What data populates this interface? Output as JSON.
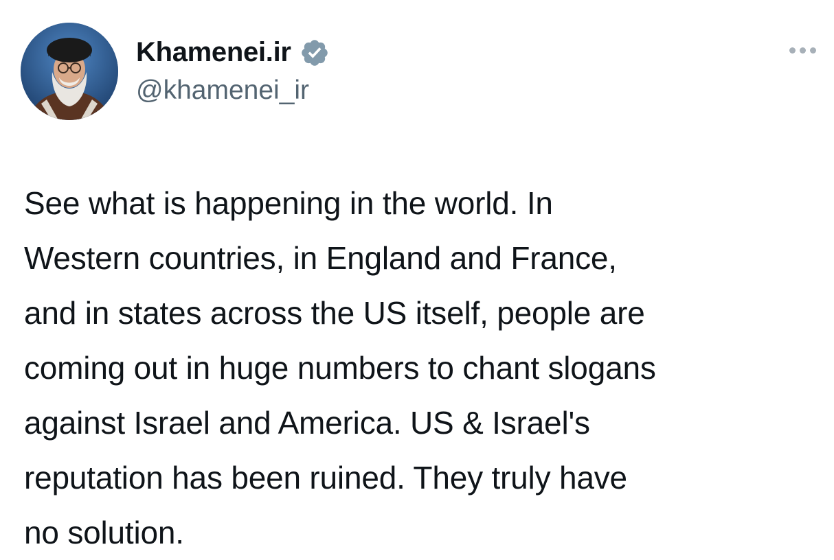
{
  "tweet": {
    "author": {
      "display_name": "Khamenei.ir",
      "handle": "@khamenei_ir",
      "avatar_icon": "avatar-portrait",
      "verified": true,
      "verified_badge_color": "#829aab"
    },
    "more_icon": "more-options-icon",
    "text_lines": [
      "See what is happening in the world. In",
      "Western countries, in England and France,",
      "and in states across the US itself, people are",
      "coming out in huge numbers to chant slogans",
      "against Israel and America. US & Israel's",
      "reputation has been ruined. They truly have",
      "no solution."
    ]
  },
  "colors": {
    "text_primary": "#0f1419",
    "text_secondary": "#536471",
    "background": "#ffffff",
    "more_dots": "#a7b0b8"
  }
}
